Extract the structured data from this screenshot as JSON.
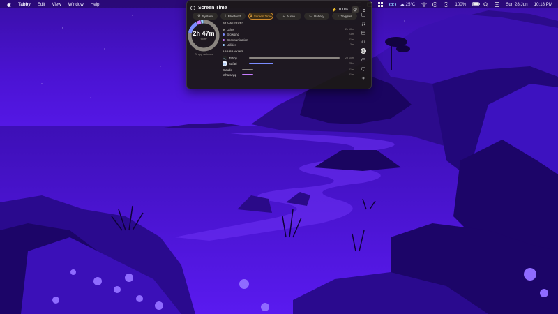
{
  "menubar": {
    "apple_icon": "apple-logo-icon",
    "app_name": "Tabby",
    "menus": [
      "Edit",
      "View",
      "Window",
      "Help"
    ],
    "temperature": "25°C",
    "battery": "100%",
    "date": "Sun 28 Jun",
    "time": "10:18 PM"
  },
  "panel": {
    "title": "Screen Time",
    "battery_label": "100%",
    "tabs": [
      {
        "label": "System",
        "icon": "gear-icon"
      },
      {
        "label": "Bluetooth",
        "icon": "bluetooth-icon"
      },
      {
        "label": "Screen Time",
        "icon": "hourglass-icon",
        "active": true
      },
      {
        "label": "Audio",
        "icon": "headphones-icon"
      },
      {
        "label": "Battery",
        "icon": "battery-icon"
      },
      {
        "label": "Toggles",
        "icon": "toggle-icon"
      }
    ],
    "donut": {
      "total": "2h 47m",
      "subtitle": "today",
      "footer": "76 app switches",
      "segments": [
        {
          "name": "Other",
          "fraction": 0.78,
          "color": "#8a8580"
        },
        {
          "name": "Browsing",
          "fraction": 0.14,
          "color": "#7b8cff"
        },
        {
          "name": "Communication",
          "fraction": 0.05,
          "color": "#c77dff"
        },
        {
          "name": "Utilities",
          "fraction": 0.03,
          "color": "#9bd0ff"
        }
      ]
    },
    "by_category_label": "BY CATEGORY",
    "categories": [
      {
        "label": "Other",
        "value": "2h 10m",
        "color": "#8a8580"
      },
      {
        "label": "Browsing",
        "value": "23m",
        "color": "#7b8cff"
      },
      {
        "label": "Communication",
        "value": "11m",
        "color": "#c77dff"
      },
      {
        "label": "Utilities",
        "value": "3m",
        "color": "#9bd0ff"
      }
    ],
    "app_ranking_label": "APP RANKING",
    "apps": [
      {
        "label": "Tabby",
        "value": "2h 10m",
        "fraction": 1.0,
        "color": "#8a8580"
      },
      {
        "label": "Safari",
        "value": "23m",
        "fraction": 0.27,
        "color": "#7b8cff"
      },
      {
        "label": "Claude",
        "value": "11m",
        "fraction": 0.12,
        "color": "#8a8580"
      },
      {
        "label": "WhatsApp",
        "value": "11m",
        "fraction": 0.12,
        "color": "#c77dff"
      }
    ]
  },
  "colors": {
    "accent": "#f4b14a",
    "panel_bg": "#1c1816",
    "wallpaper": "#4a12c8"
  }
}
